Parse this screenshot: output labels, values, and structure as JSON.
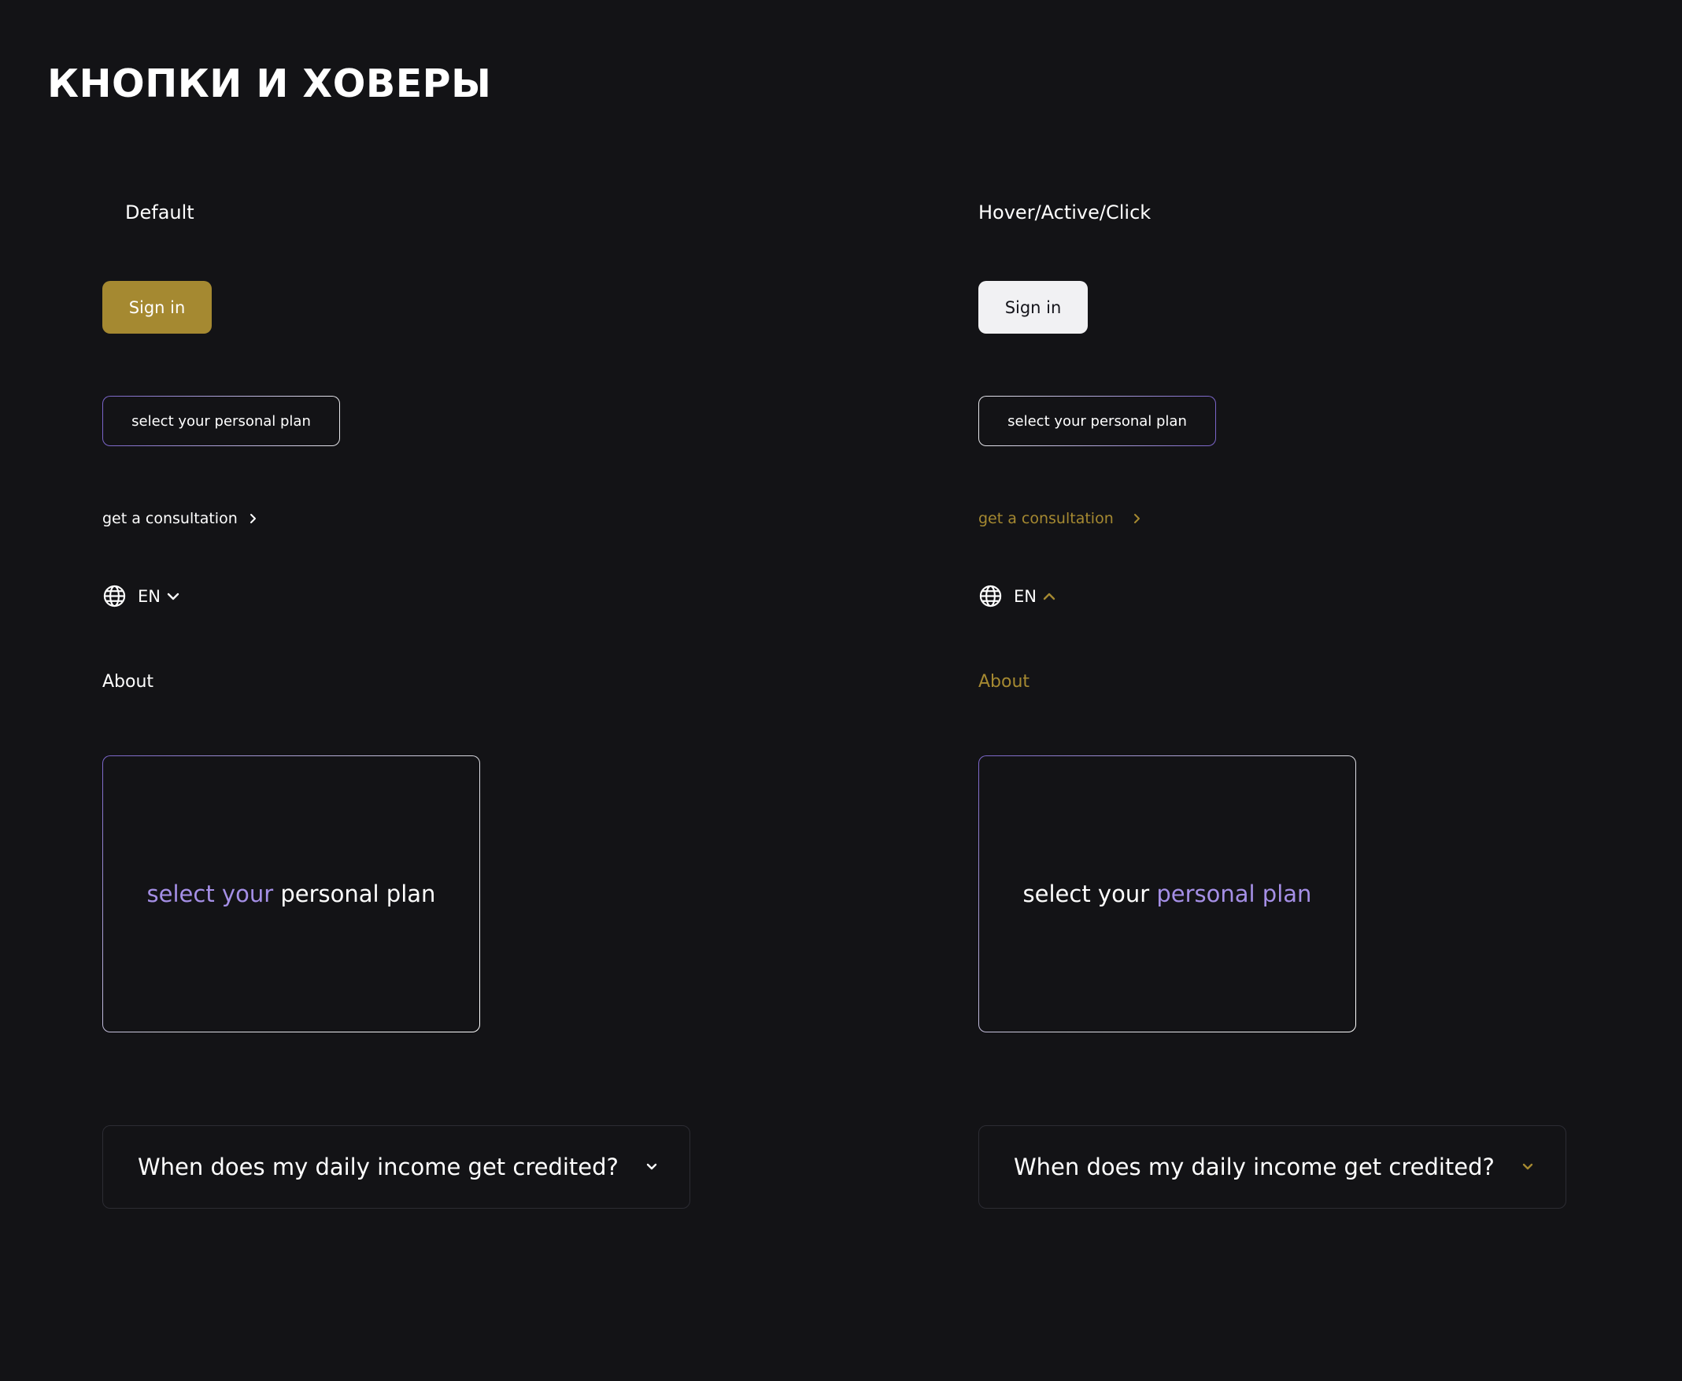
{
  "page": {
    "title": "КНОПКИ И ХОВЕРЫ"
  },
  "colors": {
    "background": "#131316",
    "gold": "#a58931",
    "lilac": "#a58fe6",
    "light_button": "#f1f1f3",
    "faq_border": "#2c2c33"
  },
  "default_state": {
    "heading": "Default",
    "signin_label": "Sign in",
    "plan_button_label": "select your personal plan",
    "consultation_label": "get a consultation",
    "language_code": "EN",
    "language_arrow": "chevron-down-icon",
    "about_label": "About",
    "plan_card": {
      "part1": "select your",
      "part2": "personal plan"
    },
    "faq_question": "When does my daily income get credited?"
  },
  "hover_state": {
    "heading": "Hover/Active/Click",
    "signin_label": "Sign in",
    "plan_button_label": "select your personal plan",
    "consultation_label": "get a consultation",
    "language_code": "EN",
    "language_arrow": "chevron-up-icon",
    "about_label": "About",
    "plan_card": {
      "part1": "select your",
      "part2": "personal plan"
    },
    "faq_question": "When does my daily income get credited?"
  }
}
